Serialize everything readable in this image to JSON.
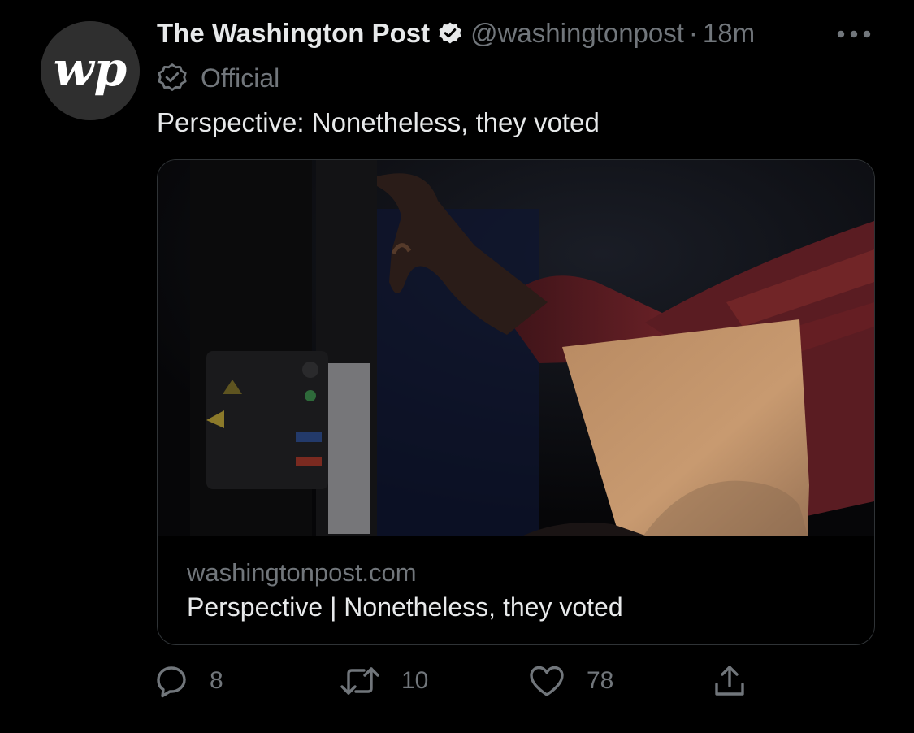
{
  "tweet": {
    "display_name": "The Washington Post",
    "handle": "@washingtonpost",
    "separator": "·",
    "timestamp": "18m",
    "label": "Official",
    "text": "Perspective: Nonetheless, they voted",
    "avatar_logo": "wp",
    "card": {
      "domain": "washingtonpost.com",
      "title": "Perspective | Nonetheless, they voted"
    },
    "actions": {
      "replies": "8",
      "retweets": "10",
      "likes": "78"
    },
    "icons": {
      "verified": "verified-check-icon",
      "official": "official-badge-icon",
      "more": "more-dots-icon",
      "reply": "reply-icon",
      "retweet": "retweet-icon",
      "like": "heart-icon",
      "share": "share-icon"
    },
    "colors": {
      "background": "#000000",
      "text": "#e7e9ea",
      "muted": "#71767b",
      "border": "#2f3336"
    }
  }
}
